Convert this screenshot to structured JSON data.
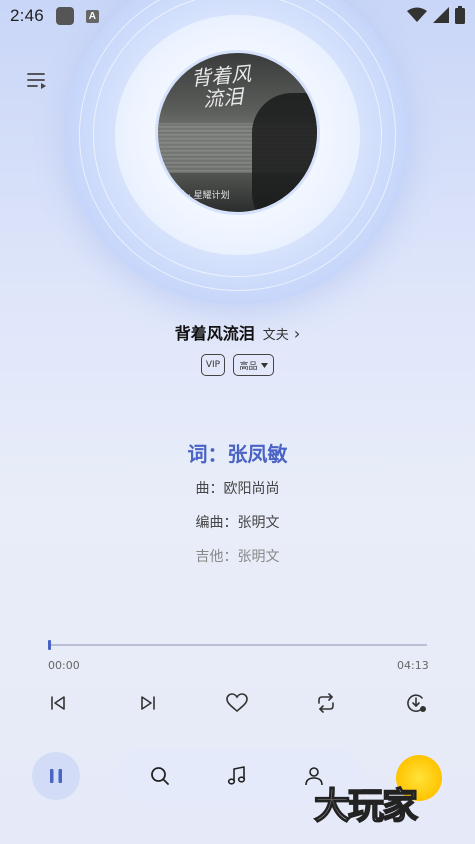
{
  "status_bar": {
    "time": "2:46",
    "a_icon_label": "A"
  },
  "song": {
    "title": "背着风流泪",
    "artist": "文夫",
    "artist_chevron": "›",
    "badge_vip": "VIP",
    "badge_quality": "高品"
  },
  "album": {
    "title_line1": "背着风",
    "title_line2": "流泪",
    "caption": "乐 · 星耀计划"
  },
  "lyrics": {
    "active": "词：张凤敏",
    "lines": [
      "曲：欧阳尚尚",
      "编曲：张明文",
      "吉他：张明文"
    ]
  },
  "progress": {
    "current_time": "00:00",
    "total_time": "04:13",
    "fraction": 0.005
  },
  "watermark": {
    "text": "大玩家"
  },
  "colors": {
    "accent": "#4a63c4"
  }
}
